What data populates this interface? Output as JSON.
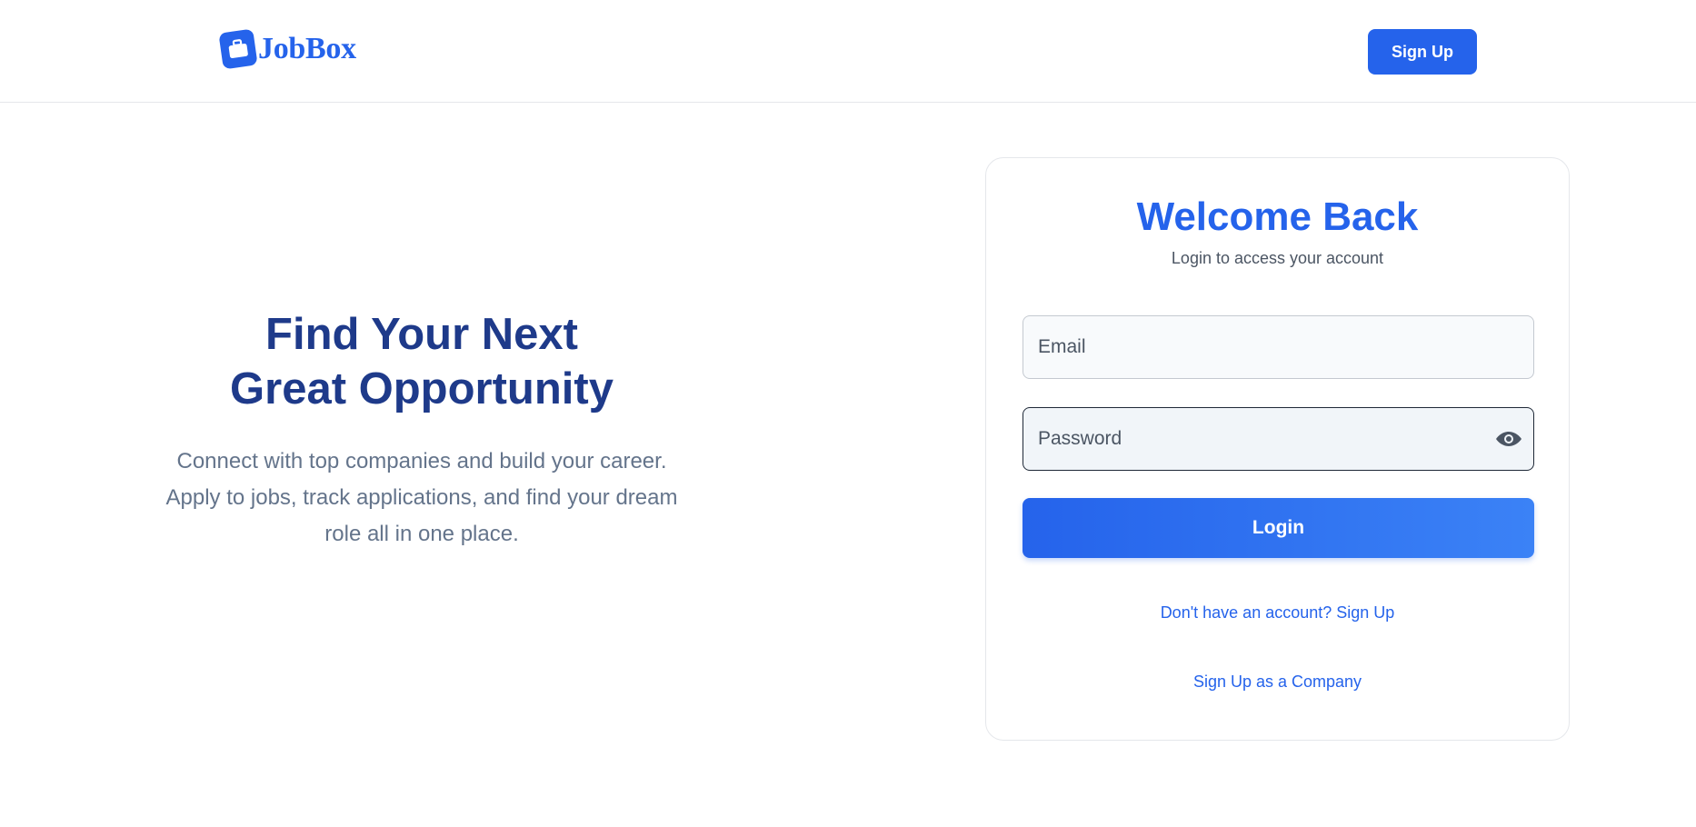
{
  "header": {
    "logo_text": "JobBox",
    "signup_label": "Sign Up"
  },
  "hero": {
    "title_line1": "Find Your Next",
    "title_line2": "Great Opportunity",
    "subtitle": "Connect with top companies and build your career. Apply to jobs, track applications, and find your dream role all in one place."
  },
  "login": {
    "title": "Welcome Back",
    "subtitle": "Login to access your account",
    "email_placeholder": "Email",
    "password_placeholder": "Password",
    "submit_label": "Login",
    "signup_link": "Don't have an account? Sign Up",
    "company_link": "Sign Up as a Company"
  },
  "icons": {
    "logo": "briefcase-icon",
    "password_toggle": "eye-icon"
  },
  "colors": {
    "primary": "#2563eb",
    "hero_title": "#1e3a8a",
    "muted_text": "#64748b"
  }
}
